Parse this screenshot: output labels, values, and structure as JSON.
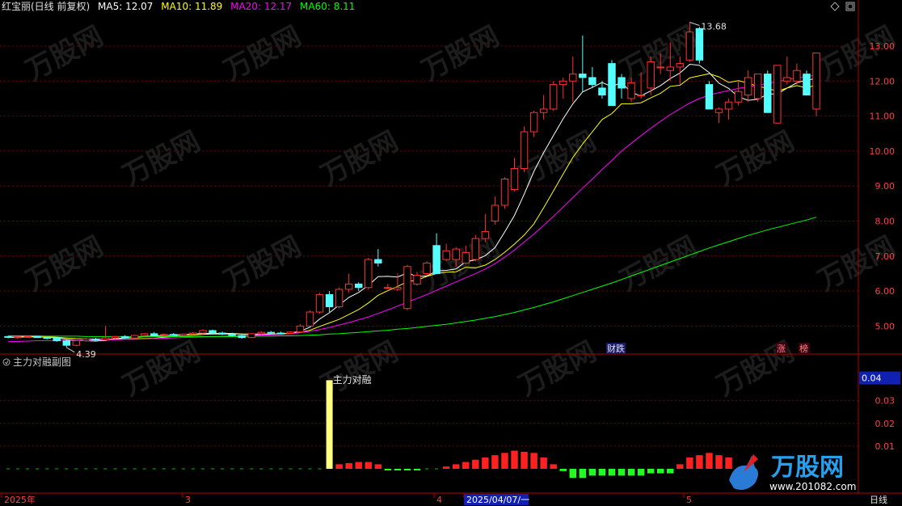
{
  "header": {
    "stock": "红宝丽(日线 前复权)",
    "ma": [
      {
        "label": "MA5: 12.07",
        "color": "#ffffff"
      },
      {
        "label": "MA10: 11.89",
        "color": "#ffff00"
      },
      {
        "label": "MA20: 12.17",
        "color": "#ff00ff"
      },
      {
        "label": "MA60: 8.11",
        "color": "#00ff00"
      }
    ]
  },
  "sub_header": {
    "title": "主力对融副图"
  },
  "watermark": {
    "brand": "万股网",
    "url": "www.201082.com"
  },
  "x_axis": {
    "labels": [
      "2025年",
      "3",
      "4",
      "2025/04/07/一",
      "5"
    ],
    "period": "日线"
  },
  "colors": {
    "up": "#ff3030",
    "down": "#54ffff",
    "grid": "#7a0000",
    "bg": "#000000",
    "axis": "#b00000"
  },
  "chart_data": [
    {
      "type": "candlestick",
      "title": "红宝丽(日线 前复权)",
      "y_ticks": [
        "13.00",
        "12.00",
        "11.00",
        "10.00",
        "9.00",
        "8.00",
        "7.00",
        "6.00",
        "5.00"
      ],
      "ylim": [
        4.2,
        13.9
      ],
      "annotations": {
        "high_label": "13.68",
        "low_label": "4.39",
        "event_1": "财跌",
        "event_2": "涨",
        "event_3": "榜"
      },
      "candles": [
        [
          4.7,
          4.72,
          4.65,
          4.68
        ],
        [
          4.68,
          4.71,
          4.64,
          4.69
        ],
        [
          4.69,
          4.73,
          4.66,
          4.7
        ],
        [
          4.7,
          4.72,
          4.66,
          4.67
        ],
        [
          4.67,
          4.7,
          4.62,
          4.66
        ],
        [
          4.66,
          4.68,
          4.55,
          4.58
        ],
        [
          4.58,
          4.62,
          4.39,
          4.45
        ],
        [
          4.45,
          4.6,
          4.42,
          4.58
        ],
        [
          4.58,
          4.66,
          4.55,
          4.63
        ],
        [
          4.63,
          4.66,
          4.58,
          4.61
        ],
        [
          4.61,
          5.0,
          4.6,
          4.66
        ],
        [
          4.66,
          4.72,
          4.63,
          4.7
        ],
        [
          4.7,
          4.74,
          4.64,
          4.66
        ],
        [
          4.66,
          4.75,
          4.64,
          4.73
        ],
        [
          4.73,
          4.8,
          4.7,
          4.78
        ],
        [
          4.78,
          4.83,
          4.72,
          4.74
        ],
        [
          4.74,
          4.79,
          4.7,
          4.76
        ],
        [
          4.76,
          4.8,
          4.71,
          4.73
        ],
        [
          4.73,
          4.79,
          4.7,
          4.77
        ],
        [
          4.77,
          4.83,
          4.74,
          4.8
        ],
        [
          4.8,
          4.91,
          4.77,
          4.87
        ],
        [
          4.87,
          4.9,
          4.76,
          4.8
        ],
        [
          4.8,
          4.84,
          4.74,
          4.77
        ],
        [
          4.77,
          4.81,
          4.7,
          4.73
        ],
        [
          4.73,
          4.76,
          4.64,
          4.67
        ],
        [
          4.67,
          4.8,
          4.65,
          4.78
        ],
        [
          4.78,
          4.85,
          4.74,
          4.82
        ],
        [
          4.82,
          4.86,
          4.77,
          4.8
        ],
        [
          4.8,
          4.84,
          4.76,
          4.79
        ],
        [
          4.79,
          4.85,
          4.76,
          4.83
        ],
        [
          4.83,
          5.05,
          4.82,
          5.0
        ],
        [
          5.0,
          5.45,
          4.98,
          5.4
        ],
        [
          5.4,
          5.95,
          5.35,
          5.9
        ],
        [
          5.9,
          6.0,
          5.4,
          5.55
        ],
        [
          5.55,
          6.1,
          5.5,
          6.05
        ],
        [
          6.05,
          6.5,
          5.95,
          6.2
        ],
        [
          6.2,
          6.25,
          6.0,
          6.1
        ],
        [
          6.1,
          6.95,
          6.05,
          6.9
        ],
        [
          6.9,
          7.2,
          6.7,
          6.8
        ],
        [
          6.1,
          6.2,
          6.05,
          6.1
        ],
        [
          6.05,
          6.5,
          6.0,
          6.1
        ],
        [
          5.5,
          6.75,
          5.45,
          6.7
        ],
        [
          6.2,
          6.55,
          6.15,
          6.45
        ],
        [
          6.5,
          6.85,
          6.45,
          6.8
        ],
        [
          7.3,
          7.65,
          6.5,
          6.5
        ],
        [
          6.9,
          7.35,
          6.85,
          7.15
        ],
        [
          6.9,
          7.25,
          6.7,
          7.2
        ],
        [
          6.8,
          7.3,
          6.75,
          7.1
        ],
        [
          6.9,
          7.6,
          6.85,
          7.5
        ],
        [
          7.5,
          8.2,
          7.4,
          7.7
        ],
        [
          8.0,
          8.7,
          7.9,
          8.45
        ],
        [
          8.45,
          9.25,
          8.35,
          9.2
        ],
        [
          8.9,
          9.8,
          8.85,
          9.5
        ],
        [
          9.5,
          10.7,
          9.4,
          10.55
        ],
        [
          10.55,
          11.15,
          10.4,
          11.1
        ],
        [
          11.1,
          11.6,
          10.9,
          11.2
        ],
        [
          11.2,
          12.0,
          11.15,
          11.9
        ],
        [
          11.9,
          12.1,
          11.5,
          12.0
        ],
        [
          12.0,
          12.7,
          11.4,
          12.2
        ],
        [
          12.2,
          13.3,
          11.7,
          12.1
        ],
        [
          12.1,
          12.4,
          11.8,
          11.9
        ],
        [
          11.8,
          12.0,
          11.5,
          11.6
        ],
        [
          12.5,
          12.6,
          11.3,
          11.3
        ],
        [
          12.1,
          12.2,
          11.5,
          11.8
        ],
        [
          11.5,
          12.1,
          11.4,
          11.95
        ],
        [
          11.6,
          12.25,
          11.5,
          11.6
        ],
        [
          11.8,
          12.7,
          11.6,
          12.55
        ],
        [
          12.4,
          12.8,
          12.2,
          12.4
        ],
        [
          12.3,
          13.1,
          12.0,
          12.4
        ],
        [
          12.4,
          12.7,
          11.9,
          12.5
        ],
        [
          12.6,
          13.68,
          12.55,
          13.4
        ],
        [
          13.5,
          13.55,
          12.5,
          12.6
        ],
        [
          11.9,
          12.0,
          11.2,
          11.2
        ],
        [
          11.1,
          11.25,
          10.8,
          11.2
        ],
        [
          11.2,
          11.5,
          10.9,
          11.4
        ],
        [
          11.4,
          12.0,
          11.3,
          11.7
        ],
        [
          11.6,
          12.3,
          11.4,
          12.1
        ],
        [
          11.5,
          12.2,
          11.4,
          12.2
        ],
        [
          12.2,
          12.3,
          11.2,
          11.1
        ],
        [
          10.8,
          12.4,
          10.8,
          12.45
        ],
        [
          12.0,
          12.7,
          11.9,
          12.1
        ],
        [
          12.0,
          12.5,
          11.9,
          12.3
        ],
        [
          12.2,
          12.3,
          11.7,
          11.6
        ],
        [
          11.2,
          12.4,
          11.0,
          12.8
        ]
      ],
      "ma_lines": [
        {
          "name": "MA5",
          "color": "#ffffff",
          "values": [
            4.68,
            4.69,
            4.7,
            4.69,
            4.68,
            4.66,
            4.62,
            4.59,
            4.58,
            4.57,
            4.59,
            4.64,
            4.66,
            4.67,
            4.7,
            4.72,
            4.73,
            4.74,
            4.76,
            4.77,
            4.79,
            4.79,
            4.79,
            4.79,
            4.77,
            4.75,
            4.75,
            4.76,
            4.78,
            4.8,
            4.85,
            4.97,
            5.2,
            5.38,
            5.6,
            5.82,
            5.96,
            6.16,
            6.41,
            6.42,
            6.4,
            6.52,
            6.41,
            6.43,
            6.57,
            6.59,
            6.63,
            6.84,
            6.89,
            7.01,
            7.24,
            7.69,
            8.16,
            8.77,
            9.42,
            9.96,
            10.44,
            10.92,
            11.35,
            11.69,
            11.82,
            11.96,
            11.84,
            11.96,
            11.67,
            11.58,
            11.72,
            11.87,
            12.07,
            12.23,
            12.48,
            12.45,
            12.24,
            11.94,
            11.79,
            11.55,
            11.45,
            11.48,
            11.63,
            11.63,
            11.8,
            11.95,
            12.03,
            12.07
          ]
        },
        {
          "name": "MA10",
          "color": "#ffff00",
          "values": [
            4.67,
            4.68,
            4.69,
            4.69,
            4.69,
            4.68,
            4.66,
            4.64,
            4.63,
            4.62,
            4.62,
            4.63,
            4.63,
            4.63,
            4.64,
            4.65,
            4.68,
            4.7,
            4.72,
            4.74,
            4.76,
            4.77,
            4.77,
            4.77,
            4.77,
            4.77,
            4.77,
            4.77,
            4.78,
            4.79,
            4.82,
            4.88,
            4.99,
            5.09,
            5.19,
            5.33,
            5.47,
            5.66,
            5.88,
            6.01,
            6.13,
            6.27,
            6.31,
            6.42,
            6.5,
            6.54,
            6.55,
            6.68,
            6.66,
            6.74,
            6.9,
            7.11,
            7.34,
            7.6,
            7.92,
            8.38,
            8.86,
            9.34,
            9.82,
            10.2,
            10.55,
            10.9,
            11.07,
            11.35,
            11.35,
            11.38,
            11.52,
            11.65,
            11.85,
            11.88,
            12.09,
            12.15,
            12.21,
            12.12,
            11.96,
            12.01,
            11.94,
            11.85,
            11.79,
            11.71,
            11.8,
            11.87,
            11.8,
            11.89
          ]
        },
        {
          "name": "MA20",
          "color": "#ff00ff",
          "values": [
            4.55,
            4.56,
            4.57,
            4.58,
            4.58,
            4.59,
            4.59,
            4.59,
            4.6,
            4.6,
            4.61,
            4.61,
            4.62,
            4.62,
            4.63,
            4.64,
            4.65,
            4.66,
            4.67,
            4.68,
            4.69,
            4.7,
            4.71,
            4.72,
            4.72,
            4.73,
            4.74,
            4.75,
            4.76,
            4.78,
            4.81,
            4.85,
            4.9,
            4.96,
            5.03,
            5.1,
            5.18,
            5.26,
            5.36,
            5.46,
            5.57,
            5.68,
            5.79,
            5.9,
            6.02,
            6.14,
            6.26,
            6.38,
            6.5,
            6.63,
            6.78,
            6.97,
            7.17,
            7.4,
            7.63,
            7.88,
            8.13,
            8.4,
            8.67,
            8.94,
            9.2,
            9.47,
            9.73,
            10.0,
            10.22,
            10.44,
            10.65,
            10.85,
            11.04,
            11.21,
            11.37,
            11.5,
            11.6,
            11.67,
            11.73,
            11.79,
            11.84,
            11.88,
            11.93,
            11.98,
            12.04,
            12.09,
            12.13,
            12.17
          ]
        },
        {
          "name": "MA60",
          "color": "#00ff00",
          "values": [
            4.72,
            4.72,
            4.72,
            4.72,
            4.71,
            4.71,
            4.71,
            4.71,
            4.7,
            4.7,
            4.7,
            4.7,
            4.7,
            4.7,
            4.7,
            4.7,
            4.7,
            4.7,
            4.7,
            4.7,
            4.7,
            4.7,
            4.7,
            4.7,
            4.7,
            4.71,
            4.71,
            4.71,
            4.72,
            4.72,
            4.73,
            4.74,
            4.75,
            4.77,
            4.78,
            4.8,
            4.82,
            4.84,
            4.86,
            4.88,
            4.91,
            4.93,
            4.96,
            4.99,
            5.02,
            5.05,
            5.09,
            5.13,
            5.17,
            5.22,
            5.27,
            5.33,
            5.39,
            5.46,
            5.53,
            5.61,
            5.69,
            5.78,
            5.87,
            5.96,
            6.05,
            6.14,
            6.23,
            6.33,
            6.43,
            6.53,
            6.63,
            6.73,
            6.83,
            6.93,
            7.03,
            7.13,
            7.23,
            7.32,
            7.41,
            7.5,
            7.59,
            7.67,
            7.75,
            7.82,
            7.89,
            7.96,
            8.03,
            8.11
          ]
        }
      ]
    },
    {
      "type": "bar",
      "title": "主力对融副图",
      "series_name": "主力对融",
      "y_ticks": [
        "0.03",
        "0.02",
        "0.01"
      ],
      "current_value": "0.04",
      "ylim": [
        0,
        0.042
      ],
      "values": [
        0,
        0,
        0,
        0,
        0,
        0,
        0,
        0,
        0,
        0,
        0,
        0,
        0,
        0,
        0,
        0,
        0,
        0,
        0,
        0,
        0,
        0,
        0,
        0,
        0,
        0,
        0,
        0,
        0,
        0,
        0,
        0,
        0,
        0.039,
        0.002,
        0.0025,
        0.003,
        0.003,
        0.002,
        -0.0005,
        -0.0005,
        -0.0005,
        -0.0005,
        0,
        0,
        0.001,
        0.002,
        0.003,
        0.004,
        0.005,
        0.006,
        0.007,
        0.008,
        0.0075,
        0.007,
        0.005,
        0.002,
        -0.001,
        -0.004,
        -0.004,
        -0.003,
        -0.003,
        -0.003,
        -0.003,
        -0.003,
        -0.003,
        -0.002,
        -0.002,
        -0.002,
        0.002,
        0.005,
        0.006,
        0.007,
        0.006,
        0.005
      ]
    }
  ]
}
